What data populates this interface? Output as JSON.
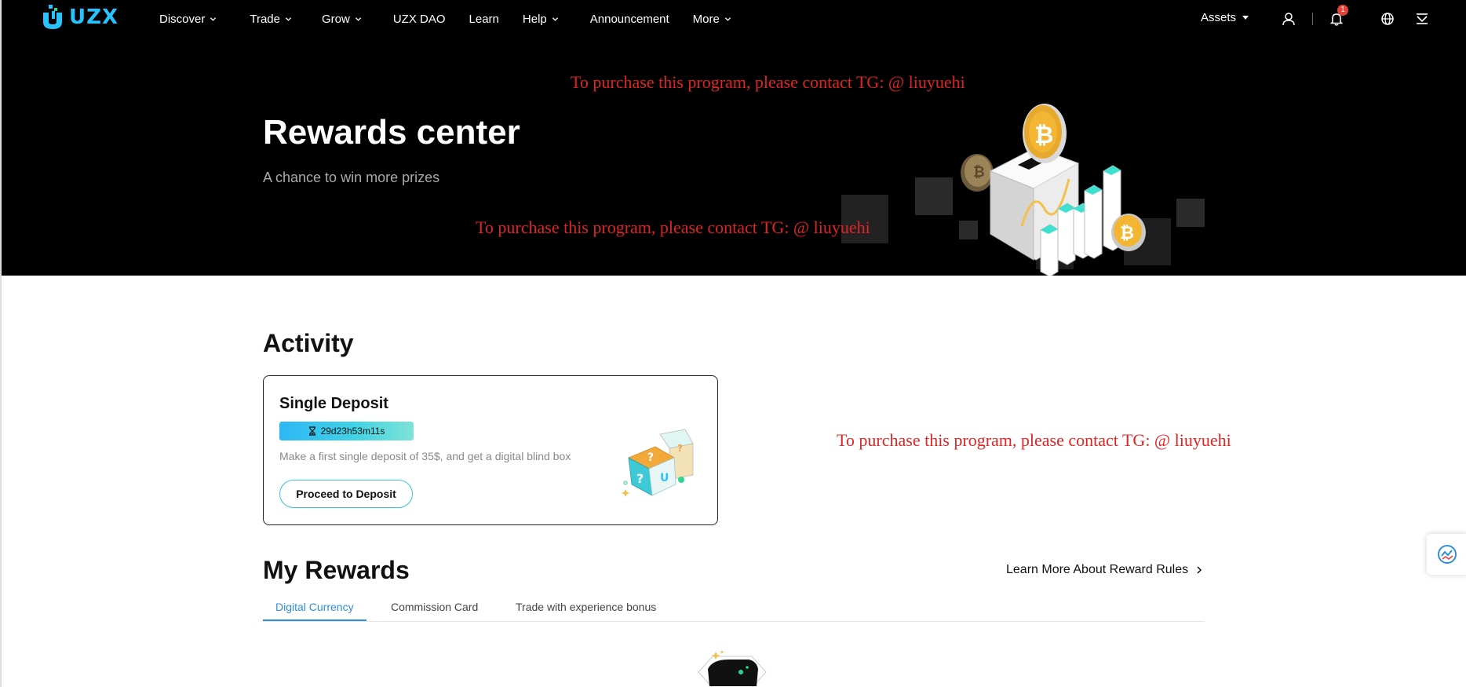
{
  "brand": {
    "name": "UZX",
    "accent": "#27c3ff"
  },
  "nav": {
    "items": [
      {
        "label": "Discover",
        "has_dropdown": true
      },
      {
        "label": "Trade",
        "has_dropdown": true
      },
      {
        "label": "Grow",
        "has_dropdown": true
      },
      {
        "label": "UZX DAO",
        "has_dropdown": false
      },
      {
        "label": "Learn",
        "has_dropdown": false
      },
      {
        "label": "Help",
        "has_dropdown": true
      },
      {
        "label": "Announcement",
        "has_dropdown": false
      },
      {
        "label": "More",
        "has_dropdown": true
      }
    ],
    "assets_label": "Assets",
    "notification_count": "1",
    "icons": [
      "user-icon",
      "bell-icon",
      "globe-icon",
      "download-icon"
    ]
  },
  "hero": {
    "title": "Rewards center",
    "subtitle": "A chance to win more prizes"
  },
  "watermarks": [
    "To purchase this program, please contact TG: @ liuyuehi",
    "To purchase this program, please contact TG: @ liuyuehi",
    "To purchase this program, please contact TG: @ liuyuehi"
  ],
  "activity": {
    "section_title": "Activity",
    "card": {
      "title": "Single Deposit",
      "timer": "29d23h53m11s",
      "description": "Make a first single deposit of 35$, and get a digital blind box",
      "button_label": "Proceed to Deposit"
    }
  },
  "rewards": {
    "section_title": "My Rewards",
    "learn_more_label": "Learn More About Reward Rules",
    "tabs": [
      {
        "label": "Digital Currency",
        "active": true
      },
      {
        "label": "Commission Card",
        "active": false
      },
      {
        "label": "Trade with experience bonus",
        "active": false
      }
    ]
  },
  "colors": {
    "nav_bg": "#000000",
    "watermark": "#e02424",
    "active_tab": "#2f8fd8",
    "timer_gradient_start": "#2db7f5",
    "timer_gradient_end": "#7fe3d6"
  }
}
